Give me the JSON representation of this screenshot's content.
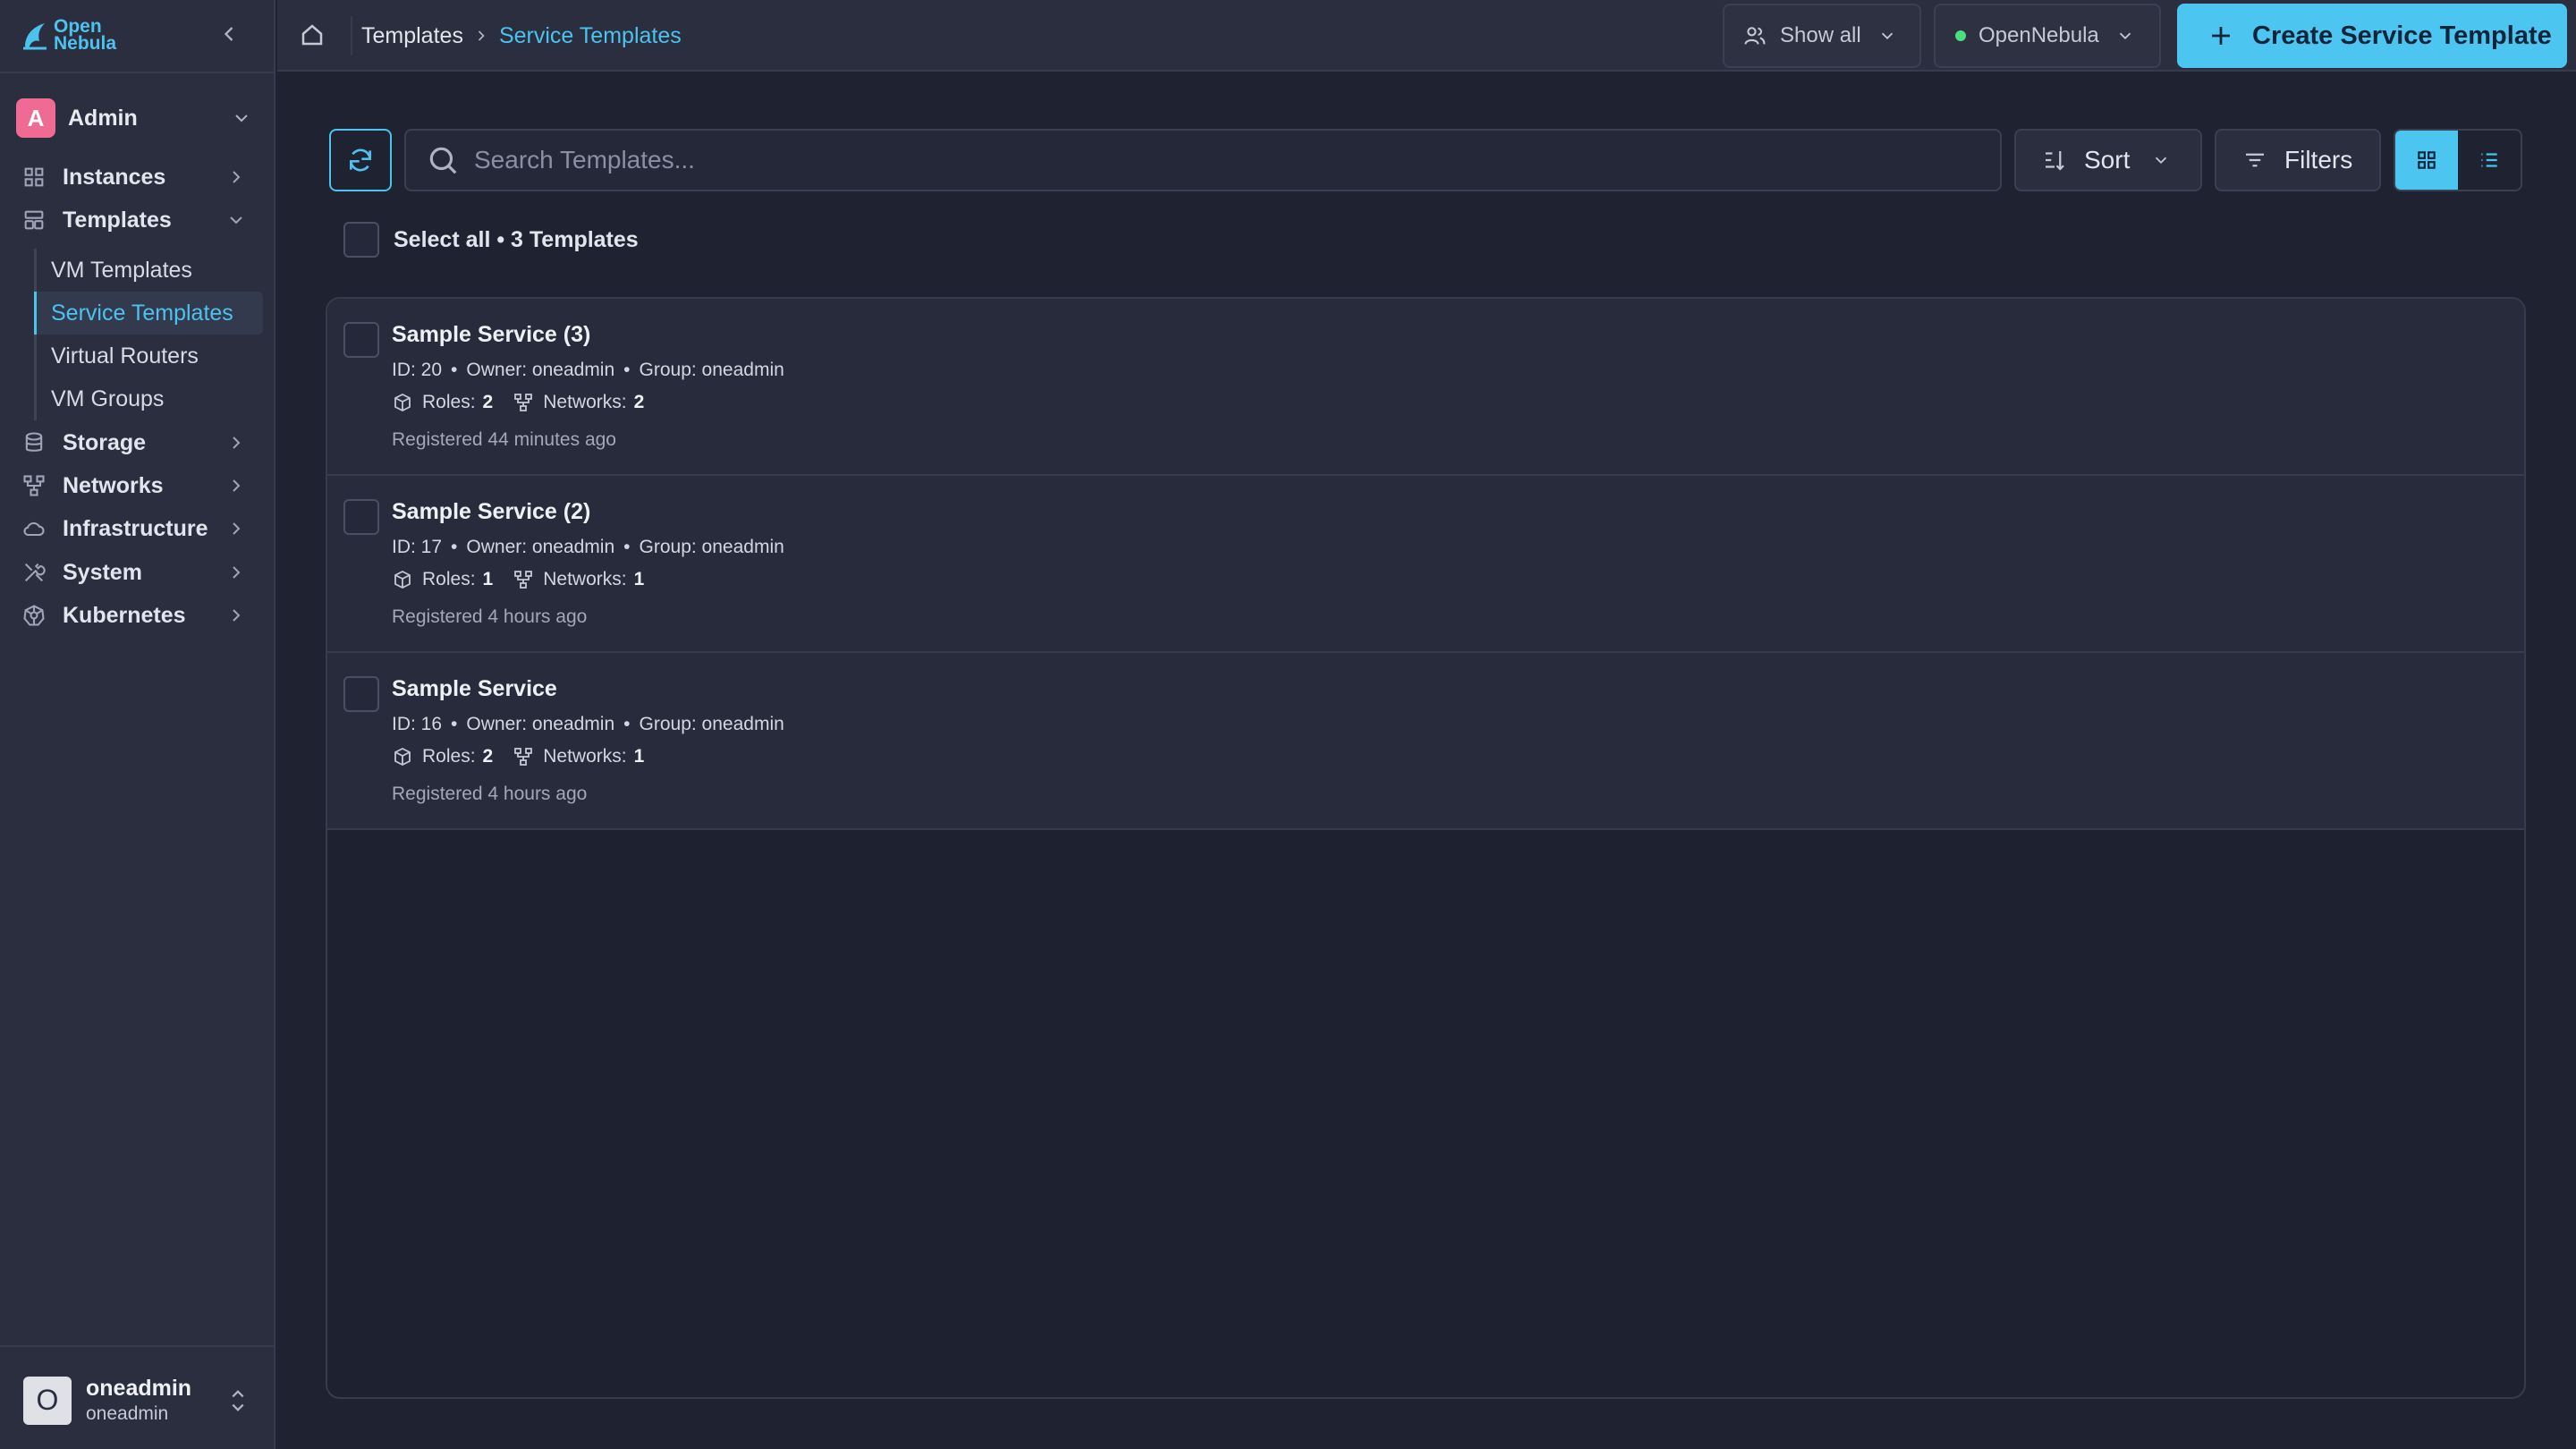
{
  "sidebar": {
    "logo": {
      "line1": "Open",
      "line2": "Nebula"
    },
    "account": {
      "initial": "A",
      "name": "Admin"
    },
    "nav": [
      {
        "label": "Instances"
      },
      {
        "label": "Templates"
      },
      {
        "label": "Storage"
      },
      {
        "label": "Networks"
      },
      {
        "label": "Infrastructure"
      },
      {
        "label": "System"
      },
      {
        "label": "Kubernetes"
      }
    ],
    "templates_sub": [
      {
        "label": "VM Templates"
      },
      {
        "label": "Service Templates"
      },
      {
        "label": "Virtual Routers"
      },
      {
        "label": "VM Groups"
      }
    ],
    "user": {
      "initial": "O",
      "name": "oneadmin",
      "group": "oneadmin"
    }
  },
  "header": {
    "breadcrumb": {
      "parent": "Templates",
      "current": "Service Templates"
    },
    "show_all_label": "Show all",
    "zone_label": "OpenNebula",
    "create_label": "Create Service Template"
  },
  "toolbar": {
    "search_placeholder": "Search Templates...",
    "sort_label": "Sort",
    "filters_label": "Filters",
    "select_all_label": "Select all • 3 Templates"
  },
  "templates": [
    {
      "title": "Sample Service (3)",
      "id": "ID: 20",
      "owner": "Owner: oneadmin",
      "group": "Group: oneadmin",
      "roles_label": "Roles:",
      "roles": "2",
      "networks_label": "Networks:",
      "networks": "2",
      "registered": "Registered 44 minutes ago"
    },
    {
      "title": "Sample Service (2)",
      "id": "ID: 17",
      "owner": "Owner: oneadmin",
      "group": "Group: oneadmin",
      "roles_label": "Roles:",
      "roles": "1",
      "networks_label": "Networks:",
      "networks": "1",
      "registered": "Registered 4 hours ago"
    },
    {
      "title": "Sample Service",
      "id": "ID: 16",
      "owner": "Owner: oneadmin",
      "group": "Group: oneadmin",
      "roles_label": "Roles:",
      "roles": "2",
      "networks_label": "Networks:",
      "networks": "1",
      "registered": "Registered 4 hours ago"
    }
  ],
  "colors": {
    "accent": "#4cc6f0",
    "background": "#1f2230",
    "sidebar": "#2a2e3e",
    "avatar_admin": "#f06b94",
    "status_dot": "#4ade80"
  }
}
